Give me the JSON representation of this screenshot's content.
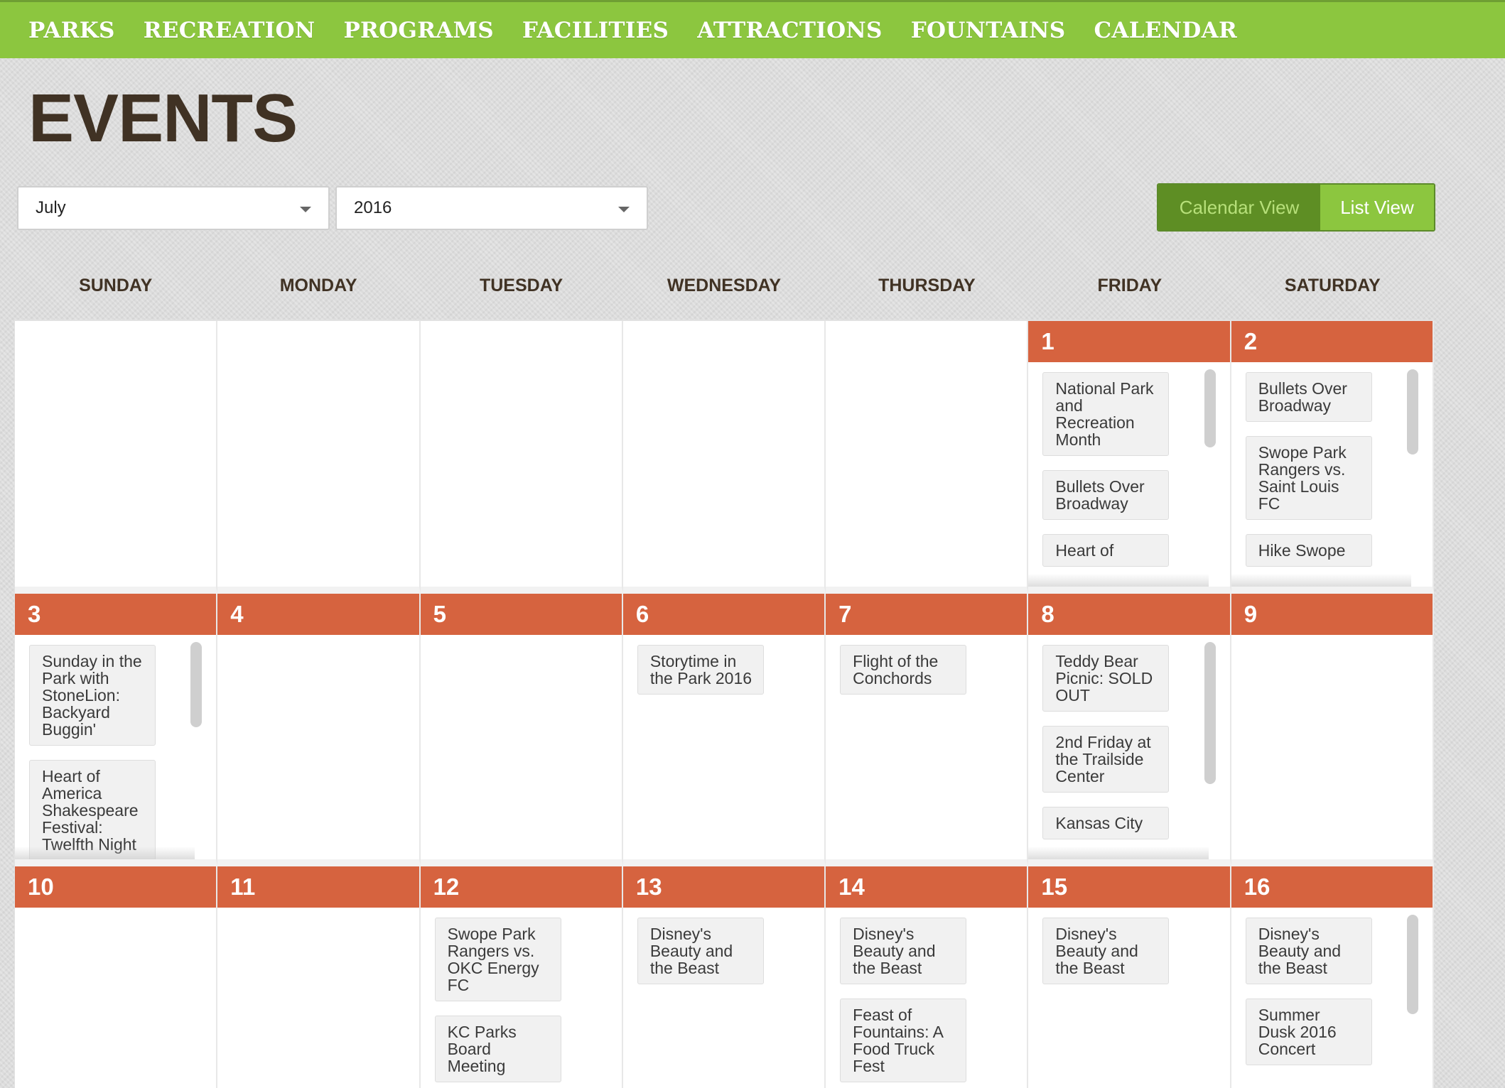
{
  "nav": {
    "items": [
      "PARKS",
      "RECREATION",
      "PROGRAMS",
      "FACILITIES",
      "ATTRACTIONS",
      "FOUNTAINS",
      "CALENDAR"
    ]
  },
  "page": {
    "title": "EVENTS"
  },
  "filters": {
    "month": "July",
    "year": "2016"
  },
  "view_toggle": {
    "calendar_label": "Calendar View",
    "list_label": "List View"
  },
  "weekdays": [
    "SUNDAY",
    "MONDAY",
    "TUESDAY",
    "WEDNESDAY",
    "THURSDAY",
    "FRIDAY",
    "SATURDAY"
  ],
  "colors": {
    "nav_green": "#8cc63f",
    "toggle_dark_green": "#5e8e24",
    "day_header_orange": "#d6633f",
    "title_brown": "#403224"
  },
  "weeks": [
    [
      {
        "day": "",
        "events": []
      },
      {
        "day": "",
        "events": []
      },
      {
        "day": "",
        "events": []
      },
      {
        "day": "",
        "events": []
      },
      {
        "day": "",
        "events": []
      },
      {
        "day": "1",
        "events": [
          "National Park and Recreation Month",
          "Bullets Over Broadway",
          "Heart of"
        ]
      },
      {
        "day": "2",
        "events": [
          "Bullets Over Broadway",
          "Swope Park Rangers vs. Saint Louis FC",
          "Hike Swope"
        ]
      }
    ],
    [
      {
        "day": "3",
        "events": [
          "Sunday in the Park with StoneLion: Backyard Buggin'",
          "Heart of America Shakespeare Festival: Twelfth Night"
        ]
      },
      {
        "day": "4",
        "events": []
      },
      {
        "day": "5",
        "events": []
      },
      {
        "day": "6",
        "events": [
          "Storytime in the Park 2016"
        ]
      },
      {
        "day": "7",
        "events": [
          "Flight of the Conchords"
        ]
      },
      {
        "day": "8",
        "events": [
          "Teddy Bear Picnic: SOLD OUT",
          "2nd Friday at the Trailside Center",
          "Kansas City"
        ]
      },
      {
        "day": "9",
        "events": []
      }
    ],
    [
      {
        "day": "10",
        "events": []
      },
      {
        "day": "11",
        "events": []
      },
      {
        "day": "12",
        "events": [
          "Swope Park Rangers vs. OKC Energy FC",
          "KC Parks Board Meeting"
        ]
      },
      {
        "day": "13",
        "events": [
          "Disney's Beauty and the Beast"
        ]
      },
      {
        "day": "14",
        "events": [
          "Disney's Beauty and the Beast",
          "Feast of Fountains: A Food Truck Fest"
        ]
      },
      {
        "day": "15",
        "events": [
          "Disney's Beauty and the Beast"
        ]
      },
      {
        "day": "16",
        "events": [
          "Disney's Beauty and the Beast",
          "Summer Dusk 2016 Concert"
        ]
      }
    ]
  ]
}
